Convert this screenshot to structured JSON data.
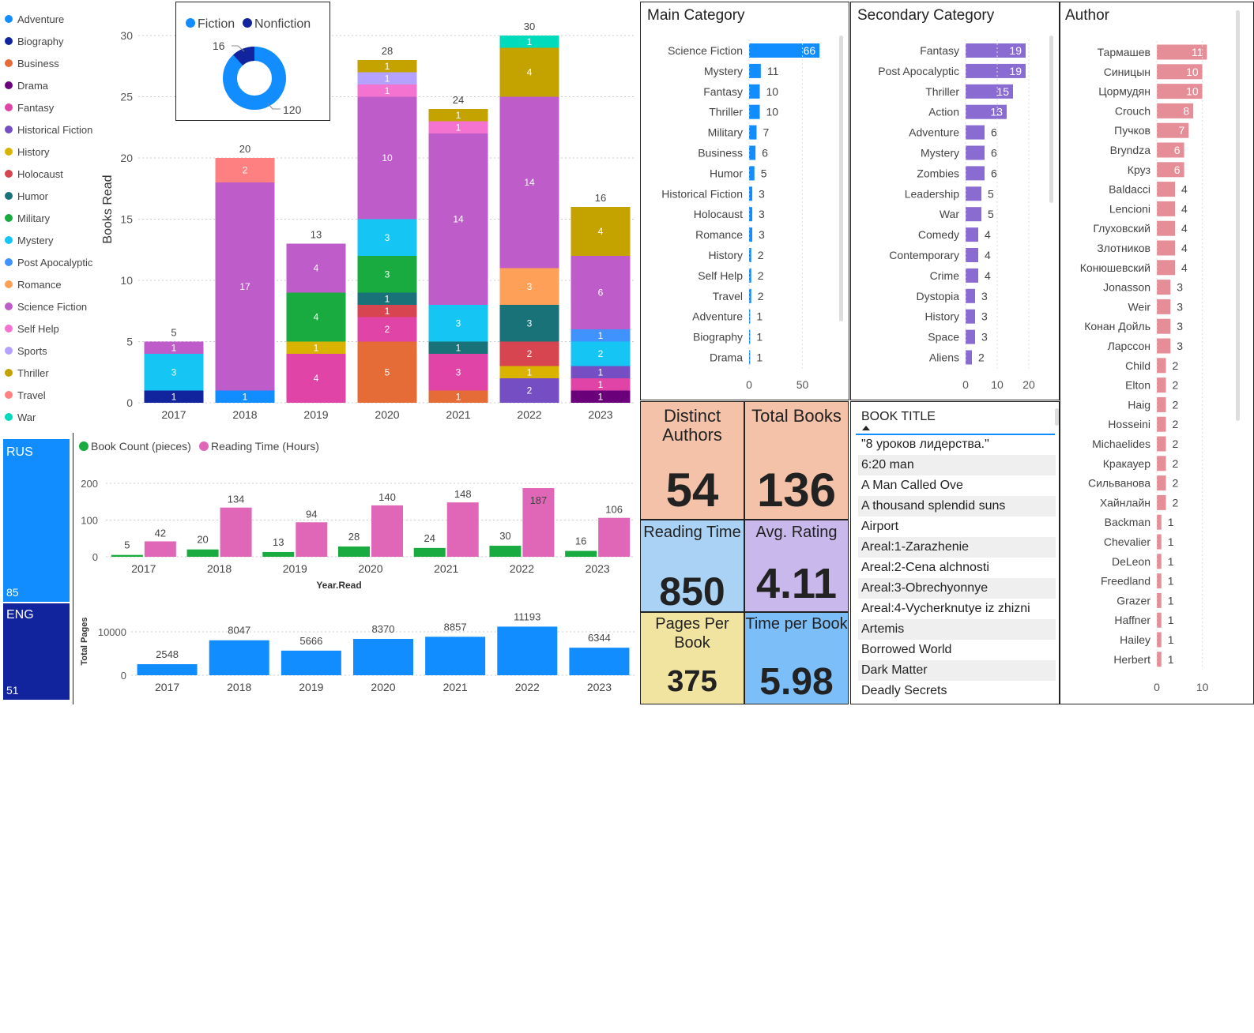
{
  "legend": [
    {
      "name": "Adventure",
      "color": "#118DFF"
    },
    {
      "name": "Biography",
      "color": "#12239E"
    },
    {
      "name": "Business",
      "color": "#E66C37"
    },
    {
      "name": "Drama",
      "color": "#6B007B"
    },
    {
      "name": "Fantasy",
      "color": "#E044A7"
    },
    {
      "name": "Historical Fiction",
      "color": "#744EC2"
    },
    {
      "name": "History",
      "color": "#D9B300"
    },
    {
      "name": "Holocaust",
      "color": "#D64550"
    },
    {
      "name": "Humor",
      "color": "#197278"
    },
    {
      "name": "Military",
      "color": "#1AAB40"
    },
    {
      "name": "Mystery",
      "color": "#15C6F4"
    },
    {
      "name": "Post Apocalyptic",
      "color": "#4092FF"
    },
    {
      "name": "Romance",
      "color": "#FFA058"
    },
    {
      "name": "Science Fiction",
      "color": "#BE5DC9"
    },
    {
      "name": "Self Help",
      "color": "#F472D0"
    },
    {
      "name": "Sports",
      "color": "#B5A1FF"
    },
    {
      "name": "Thriller",
      "color": "#C4A200"
    },
    {
      "name": "Travel",
      "color": "#FF8080"
    },
    {
      "name": "War",
      "color": "#00DBBC"
    }
  ],
  "donut": {
    "legend": [
      {
        "name": "Fiction",
        "color": "#118DFF"
      },
      {
        "name": "Nonfiction",
        "color": "#12239E"
      }
    ],
    "fiction_value": "120",
    "nonfiction_value": "16",
    "fiction": 120,
    "nonfiction": 16
  },
  "main_chart": {
    "ylabel": "Books Read",
    "yticks": [
      "0",
      "5",
      "10",
      "15",
      "20",
      "25",
      "30"
    ],
    "years": [
      "2017",
      "2018",
      "2019",
      "2020",
      "2021",
      "2022",
      "2023"
    ],
    "totals": [
      "5",
      "20",
      "13",
      "28",
      "24",
      "30",
      "16"
    ]
  },
  "chart_data": [
    {
      "type": "bar",
      "title": "",
      "ylabel": "Books Read",
      "ylim": [
        0,
        30
      ],
      "categories": [
        "2017",
        "2018",
        "2019",
        "2020",
        "2021",
        "2022",
        "2023"
      ],
      "stacks": [
        [
          {
            "genre": "Biography",
            "value": 1
          },
          {
            "genre": "Mystery",
            "value": 3
          },
          {
            "genre": "Science Fiction",
            "value": 1
          }
        ],
        [
          {
            "genre": "Adventure",
            "value": 1
          },
          {
            "genre": "Science Fiction",
            "value": 17
          },
          {
            "genre": "Travel",
            "value": 2
          }
        ],
        [
          {
            "genre": "Fantasy",
            "value": 4
          },
          {
            "genre": "History",
            "value": 1
          },
          {
            "genre": "Military",
            "value": 4
          },
          {
            "genre": "Science Fiction",
            "value": 4
          }
        ],
        [
          {
            "genre": "Business",
            "value": 5
          },
          {
            "genre": "Fantasy",
            "value": 2
          },
          {
            "genre": "Holocaust",
            "value": 1
          },
          {
            "genre": "Humor",
            "value": 1
          },
          {
            "genre": "Military",
            "value": 3
          },
          {
            "genre": "Mystery",
            "value": 3
          },
          {
            "genre": "Science Fiction",
            "value": 10
          },
          {
            "genre": "Self Help",
            "value": 1
          },
          {
            "genre": "Sports",
            "value": 1
          },
          {
            "genre": "Thriller",
            "value": 1
          }
        ],
        [
          {
            "genre": "Business",
            "value": 1
          },
          {
            "genre": "Fantasy",
            "value": 3
          },
          {
            "genre": "Humor",
            "value": 1
          },
          {
            "genre": "Mystery",
            "value": 3
          },
          {
            "genre": "Science Fiction",
            "value": 14
          },
          {
            "genre": "Self Help",
            "value": 1
          },
          {
            "genre": "Thriller",
            "value": 1
          }
        ],
        [
          {
            "genre": "Historical Fiction",
            "value": 2
          },
          {
            "genre": "History",
            "value": 1
          },
          {
            "genre": "Holocaust",
            "value": 2
          },
          {
            "genre": "Humor",
            "value": 3
          },
          {
            "genre": "Romance",
            "value": 3
          },
          {
            "genre": "Science Fiction",
            "value": 14
          },
          {
            "genre": "Thriller",
            "value": 4
          },
          {
            "genre": "War",
            "value": 1
          }
        ],
        [
          {
            "genre": "Drama",
            "value": 1
          },
          {
            "genre": "Fantasy",
            "value": 1
          },
          {
            "genre": "Historical Fiction",
            "value": 1
          },
          {
            "genre": "Mystery",
            "value": 2
          },
          {
            "genre": "Post Apocalyptic",
            "value": 1
          },
          {
            "genre": "Science Fiction",
            "value": 6
          },
          {
            "genre": "Thriller",
            "value": 4
          }
        ]
      ],
      "totals": [
        5,
        20,
        13,
        28,
        24,
        30,
        16
      ]
    },
    {
      "type": "pie",
      "legend": [
        "Fiction",
        "Nonfiction"
      ],
      "values": [
        120,
        16
      ]
    },
    {
      "type": "bar",
      "title": "",
      "xlabel": "Year.Read",
      "categories": [
        "2017",
        "2018",
        "2019",
        "2020",
        "2021",
        "2022",
        "2023"
      ],
      "ylim": [
        0,
        200
      ],
      "series": [
        {
          "name": "Book Count (pieces)",
          "values": [
            5,
            20,
            13,
            28,
            24,
            30,
            16
          ]
        },
        {
          "name": "Reading Time (Hours)",
          "values": [
            42,
            134,
            94,
            140,
            148,
            187,
            106
          ]
        }
      ]
    },
    {
      "type": "bar",
      "ylabel": "Total Pages",
      "categories": [
        "2017",
        "2018",
        "2019",
        "2020",
        "2021",
        "2022",
        "2023"
      ],
      "values": [
        2548,
        8047,
        5666,
        8370,
        8857,
        11193,
        6344
      ]
    },
    {
      "type": "bar",
      "title": "Main Category",
      "categories": [
        "Science Fiction",
        "Mystery",
        "Fantasy",
        "Thriller",
        "Military",
        "Business",
        "Humor",
        "Historical Fiction",
        "Holocaust",
        "Romance",
        "History",
        "Self Help",
        "Travel",
        "Adventure",
        "Biography",
        "Drama"
      ],
      "values": [
        66,
        11,
        10,
        10,
        7,
        6,
        5,
        3,
        3,
        3,
        2,
        2,
        2,
        1,
        1,
        1
      ]
    },
    {
      "type": "bar",
      "title": "Secondary Category",
      "categories": [
        "Fantasy",
        "Post Apocalyptic",
        "Thriller",
        "Action",
        "Adventure",
        "Mystery",
        "Zombies",
        "Leadership",
        "War",
        "Comedy",
        "Contemporary",
        "Crime",
        "Dystopia",
        "History",
        "Space",
        "Aliens"
      ],
      "values": [
        19,
        19,
        15,
        13,
        6,
        6,
        6,
        5,
        5,
        4,
        4,
        4,
        3,
        3,
        3,
        2
      ]
    },
    {
      "type": "bar",
      "title": "Author",
      "categories": [
        "Тармашев",
        "Синицын",
        "Цормудян",
        "Crouch",
        "Пучков",
        "Bryndza",
        "Круз",
        "Baldacci",
        "Lencioni",
        "Глуховский",
        "Злотников",
        "Конюшевский",
        "Jonasson",
        "Weir",
        "Конан Дойль",
        "Ларссон",
        "Child",
        "Elton",
        "Haig",
        "Hosseini",
        "Michaelides",
        "Кракауер",
        "Сильванова",
        "Хайнлайн",
        "Backman",
        "Chevalier",
        "DeLeon",
        "Freedland",
        "Grazer",
        "Haffner",
        "Hailey",
        "Herbert"
      ],
      "values": [
        11,
        10,
        10,
        8,
        7,
        6,
        6,
        4,
        4,
        4,
        4,
        4,
        3,
        3,
        3,
        3,
        2,
        2,
        2,
        2,
        2,
        2,
        2,
        2,
        1,
        1,
        1,
        1,
        1,
        1,
        1,
        1
      ]
    },
    {
      "type": "bar",
      "categories": [
        "RUS",
        "ENG"
      ],
      "values": [
        85,
        51
      ]
    }
  ],
  "lang": {
    "rus_label": "RUS",
    "rus_value": "85",
    "eng_label": "ENG",
    "eng_value": "51"
  },
  "combo": {
    "legend": [
      {
        "name": "Book Count (pieces)",
        "color": "#1AAB40"
      },
      {
        "name": "Reading Time (Hours)",
        "color": "#E066B8"
      }
    ],
    "yticks": [
      "0",
      "100",
      "200"
    ],
    "xlabel": "Year.Read",
    "years": [
      "2017",
      "2018",
      "2019",
      "2020",
      "2021",
      "2022",
      "2023"
    ],
    "counts": [
      "5",
      "20",
      "13",
      "28",
      "24",
      "30",
      "16"
    ],
    "hours": [
      "42",
      "134",
      "94",
      "140",
      "148",
      "187",
      "106"
    ]
  },
  "pages": {
    "ylabel": "Total Pages",
    "yticks": [
      "0",
      "10000"
    ],
    "years": [
      "2017",
      "2018",
      "2019",
      "2020",
      "2021",
      "2022",
      "2023"
    ],
    "values": [
      "2548",
      "8047",
      "5666",
      "8370",
      "8857",
      "11193",
      "6344"
    ]
  },
  "main_category": {
    "title": "Main Category",
    "xticks": [
      "0",
      "50"
    ]
  },
  "secondary_category": {
    "title": "Secondary Category",
    "xticks": [
      "0",
      "10",
      "20"
    ]
  },
  "author": {
    "title": "Author",
    "xticks": [
      "0",
      "10"
    ]
  },
  "kpis": {
    "distinct_authors": {
      "label": "Distinct Authors",
      "value": "54",
      "color": "#F4C2A8"
    },
    "total_books": {
      "label": "Total Books",
      "value": "136",
      "color": "#F4C2A8"
    },
    "reading_time": {
      "label": "Reading Time",
      "value": "850",
      "color": "#A9D2F5"
    },
    "avg_rating": {
      "label": "Avg. Rating",
      "value": "4.11",
      "color": "#C9B8EC"
    },
    "pages_per_book": {
      "label": "Pages Per Book",
      "value": "375",
      "color": "#F1E3A0"
    },
    "time_per_book": {
      "label": "Time per Book",
      "value": "5.98",
      "color": "#7CBEF8"
    }
  },
  "books": {
    "header": "BOOK TITLE",
    "items": [
      "\"8 уроков лидерства.\"",
      "6:20 man",
      "A Man Called Ove",
      "A thousand splendid suns",
      "Airport",
      "Areal:1-Zarazhenie",
      "Areal:2-Cena alchnosti",
      "Areal:3-Obrechyonnye",
      "Areal:4-Vycherknutye iz zhizni",
      "Artemis",
      "Borrowed World",
      "Dark Matter",
      "Deadly Secrets"
    ]
  }
}
